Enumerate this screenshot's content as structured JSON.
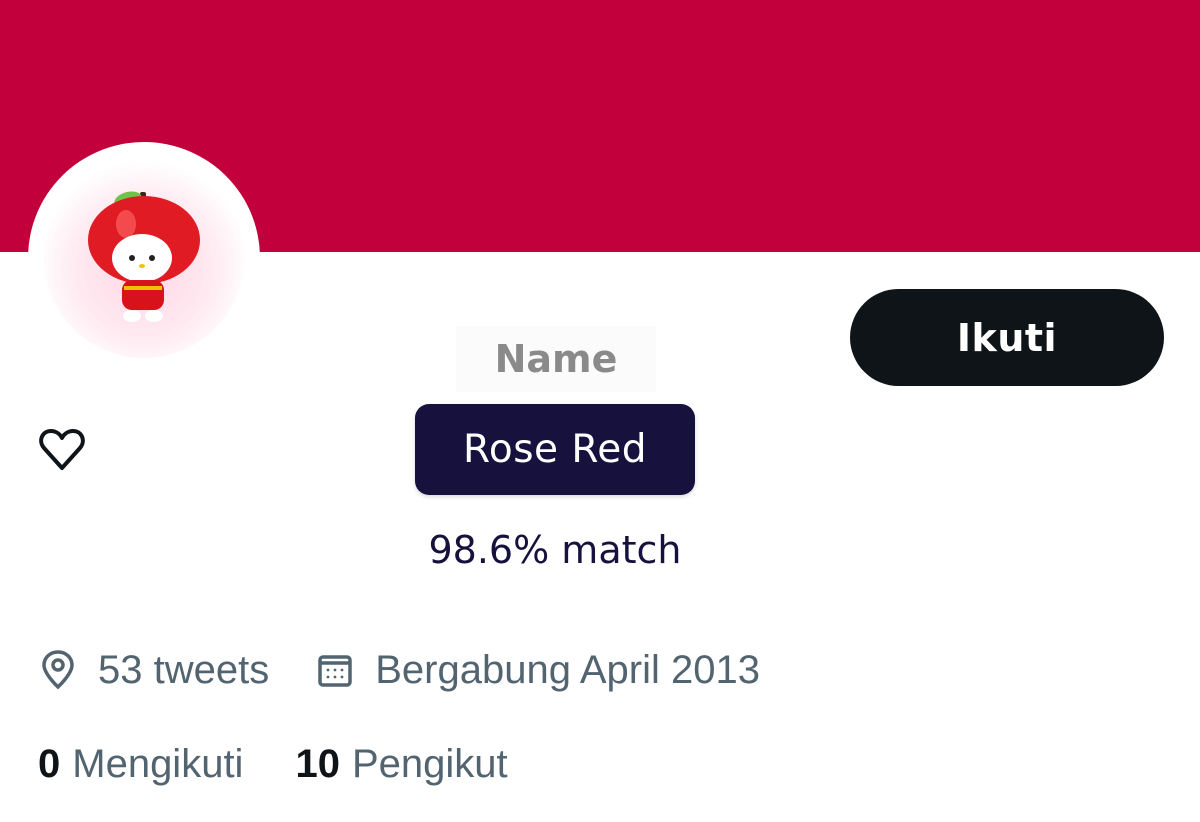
{
  "profile": {
    "banner_color": "#c2003c",
    "avatar_description": "hello-kitty-apple-figure",
    "follow_button_label": "Ikuti",
    "name_label": "Name",
    "name_value": "Rose Red",
    "match_text": "98.6% match",
    "reaction_icon": "heart-icon"
  },
  "meta": {
    "location_icon": "location-pin-icon",
    "location_text": "53 tweets",
    "joined_icon": "calendar-icon",
    "joined_text": "Bergabung April 2013"
  },
  "stats": {
    "following_count": "0",
    "following_label": "Mengikuti",
    "followers_count": "10",
    "followers_label": "Pengikut"
  }
}
